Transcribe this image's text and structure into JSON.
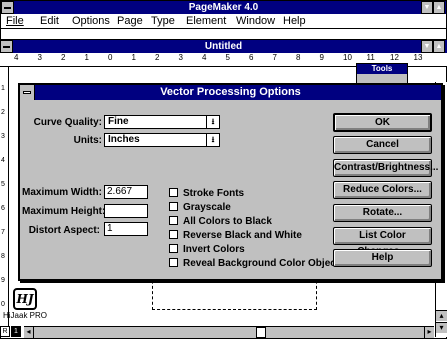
{
  "app": {
    "title": "PageMaker 4.0"
  },
  "menubar": {
    "items": [
      {
        "label": "File",
        "underline_index": 0
      },
      {
        "label": "Edit",
        "underline_index": 0
      },
      {
        "label": "Options",
        "underline_index": 0
      },
      {
        "label": "Page",
        "underline_index": 0
      },
      {
        "label": "Type",
        "underline_index": 0
      },
      {
        "label": "Element",
        "underline_index": 3
      },
      {
        "label": "Window",
        "underline_index": 0
      },
      {
        "label": "Help",
        "underline_index": 0
      }
    ]
  },
  "document": {
    "title": "Untitled",
    "ruler_numbers": [
      "4",
      "3",
      "2",
      "1",
      "0",
      "1",
      "2",
      "3",
      "4",
      "5",
      "6",
      "7",
      "8",
      "9",
      "10",
      "11",
      "12",
      "13"
    ],
    "vruler_numbers": [
      "1",
      "2",
      "3",
      "4",
      "5",
      "6",
      "7",
      "8",
      "9",
      "0"
    ],
    "tools_title": "Tools",
    "page_icons": [
      "R",
      "1"
    ]
  },
  "hijaak": {
    "logo_text": "HJ",
    "label": "HiJaak PRO"
  },
  "dialog": {
    "title": "Vector Processing Options",
    "curve_quality": {
      "label": "Curve Quality:",
      "value": "Fine"
    },
    "units": {
      "label": "Units:",
      "value": "Inches"
    },
    "max_width": {
      "label": "Maximum Width:",
      "value": "2.667"
    },
    "max_height": {
      "label": "Maximum Height:",
      "value": ""
    },
    "distort_aspect": {
      "label": "Distort Aspect:",
      "value": "1"
    },
    "checkboxes": [
      {
        "label": "Stroke Fonts",
        "checked": false
      },
      {
        "label": "Grayscale",
        "checked": false
      },
      {
        "label": "All Colors to Black",
        "checked": false
      },
      {
        "label": "Reverse Black and White",
        "checked": false
      },
      {
        "label": "Invert Colors",
        "checked": false
      },
      {
        "label": "Reveal Background Color Objects",
        "checked": false
      }
    ],
    "buttons": {
      "ok": "OK",
      "cancel": "Cancel",
      "contrast": "Contrast/Brightness...",
      "reduce_colors": "Reduce Colors...",
      "rotate": "Rotate...",
      "list_color_changes": "List Color Changes...",
      "help": "Help"
    }
  },
  "colors": {
    "titlebar": "#000080",
    "dialog_face": "#c0c0c0"
  }
}
